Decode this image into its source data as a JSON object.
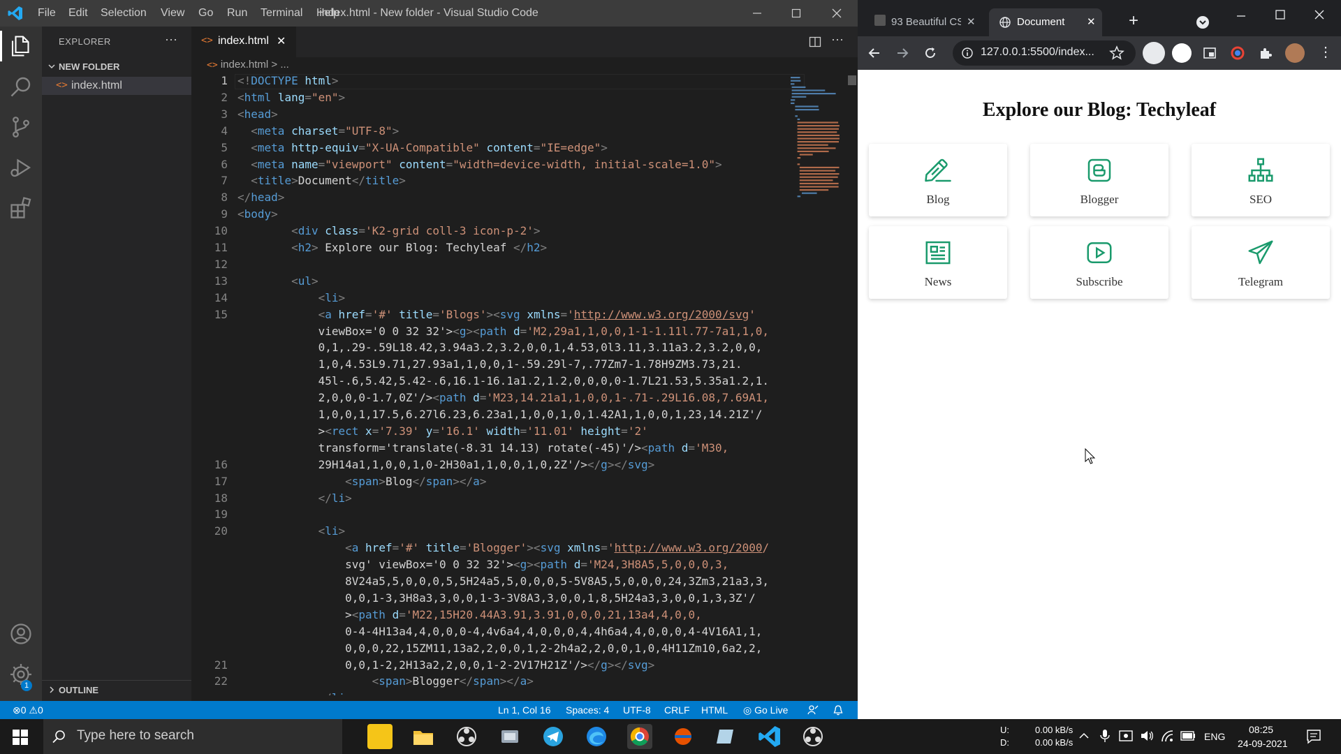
{
  "vscode": {
    "logo": "vscode-logo-icon",
    "menu": [
      "File",
      "Edit",
      "Selection",
      "View",
      "Go",
      "Run",
      "Terminal",
      "Help"
    ],
    "window_title": "index.html - New folder - Visual Studio Code",
    "activity_icons": [
      "files-icon",
      "search-icon",
      "source-control-icon",
      "run-debug-icon",
      "extensions-icon"
    ],
    "activity_bottom_icons": [
      "account-icon",
      "gear-icon"
    ],
    "settings_badge": "1",
    "sidebar": {
      "header": "EXPLORER",
      "more": "···",
      "folder": "NEW FOLDER",
      "file": "index.html",
      "outline": "OUTLINE"
    },
    "tab": {
      "label": "index.html",
      "close": "✕"
    },
    "breadcrumb": {
      "file": "index.html",
      "sep": ">",
      "rest": "..."
    },
    "line_numbers": [
      "1",
      "2",
      "3",
      "4",
      "5",
      "6",
      "7",
      "8",
      "9",
      "10",
      "11",
      "12",
      "13",
      "14",
      "15",
      "",
      "",
      "",
      "",
      "",
      "",
      "",
      "",
      "16",
      "17",
      "18",
      "19",
      "20",
      "",
      "",
      "",
      "",
      "",
      "",
      "",
      "21",
      "22"
    ],
    "code_lines": [
      "<!DOCTYPE html>",
      "<html lang=\"en\">",
      "<head>",
      "  <meta charset=\"UTF-8\">",
      "  <meta http-equiv=\"X-UA-Compatible\" content=\"IE=edge\">",
      "  <meta name=\"viewport\" content=\"width=device-width, initial-scale=1.0\">",
      "  <title>Document</title>",
      "</head>",
      "<body>",
      "        <div class='K2-grid coll-3 icon-p-2'>",
      "        <h2> Explore our Blog: Techyleaf </h2>",
      "",
      "        <ul>",
      "            <li>",
      "            <a href='#' title='Blogs'><svg xmlns='http://www.w3.org/2000/svg'",
      "            viewBox='0 0 32 32'><g><path d='M2,29a1,1,0,0,1-1-1.11l.77-7a1,1,0,",
      "            0,1,.29-.59L18.42,3.94a3.2,3.2,0,0,1,4.53,0l3.11,3.11a3.2,3.2,0,0,",
      "            1,0,4.53L9.71,27.93a1,1,0,0,1-.59.29l-7,.77Zm7-1.78H9ZM3.73,21.",
      "            45l-.6,5.42,5.42-.6,16.1-16.1a1.2,1.2,0,0,0,0-1.7L21.53,5.35a1.2,1.",
      "            2,0,0,0-1.7,0Z'/><path d='M23,14.21a1,1,0,0,1-.71-.29L16.08,7.69A1,",
      "            1,0,0,1,17.5,6.27l6.23,6.23a1,1,0,0,1,0,1.42A1,1,0,0,1,23,14.21Z'/",
      "            ><rect x='7.39' y='16.1' width='11.01' height='2'",
      "            transform='translate(-8.31 14.13) rotate(-45)'/><path d='M30,",
      "            29H14a1,1,0,0,1,0-2H30a1,1,0,0,1,0,2Z'/></g></svg>",
      "                <span>Blog</span></a>",
      "            </li>",
      "",
      "            <li>",
      "                <a href='#' title='Blogger'><svg xmlns='http://www.w3.org/2000/",
      "                svg' viewBox='0 0 32 32'><g><path d='M24,3H8A5,5,0,0,0,3,",
      "                8V24a5,5,0,0,0,5,5H24a5,5,0,0,0,5-5V8A5,5,0,0,0,24,3Zm3,21a3,3,",
      "                0,0,1-3,3H8a3,3,0,0,1-3-3V8A3,3,0,0,1,8,5H24a3,3,0,0,1,3,3Z'/",
      "                ><path d='M22,15H20.44A3.91,3.91,0,0,0,21,13a4,4,0,0,",
      "                0-4-4H13a4,4,0,0,0-4,4v6a4,4,0,0,0,4,4h6a4,4,0,0,0,4-4V16A1,1,",
      "                0,0,0,22,15ZM11,13a2,2,0,0,1,2-2h4a2,2,0,0,1,0,4H11Zm10,6a2,2,",
      "                0,0,1-2,2H13a2,2,0,0,1-2-2V17H21Z'/></g></svg>",
      "                    <span>Blogger</span></a>",
      "            </li>"
    ],
    "status": {
      "errors": "0",
      "warnings": "0",
      "position": "Ln 1, Col 16",
      "spaces": "Spaces: 4",
      "encoding": "UTF-8",
      "eol": "CRLF",
      "language": "HTML",
      "golive": "Go Live"
    }
  },
  "browser": {
    "tabs": [
      {
        "label": "93 Beautiful CS",
        "close": "✕"
      },
      {
        "label": "Document",
        "close": "✕"
      }
    ],
    "new_tab": "+",
    "url": "127.0.0.1:5500/index...",
    "page": {
      "heading": "Explore our Blog: Techyleaf",
      "cards": [
        {
          "label": "Blog",
          "icon": "pencil-icon"
        },
        {
          "label": "Blogger",
          "icon": "blogger-icon"
        },
        {
          "label": "SEO",
          "icon": "sitemap-icon"
        },
        {
          "label": "News",
          "icon": "newspaper-icon"
        },
        {
          "label": "Subscribe",
          "icon": "play-button-icon"
        },
        {
          "label": "Telegram",
          "icon": "paper-plane-icon"
        }
      ],
      "icon_color": "#1a9a6c"
    }
  },
  "taskbar": {
    "search_placeholder": "Type here to search",
    "net_up": "U:",
    "net_down": "D:",
    "net_up_val": "0.00 kB/s",
    "net_down_val": "0.00 kB/s",
    "lang": "ENG",
    "time": "08:25",
    "date": "24-09-2021"
  },
  "colors": {
    "vscode_status": "#007acc",
    "vscode_bg": "#1e1e1e",
    "taskbar": "#1a1a1a"
  }
}
